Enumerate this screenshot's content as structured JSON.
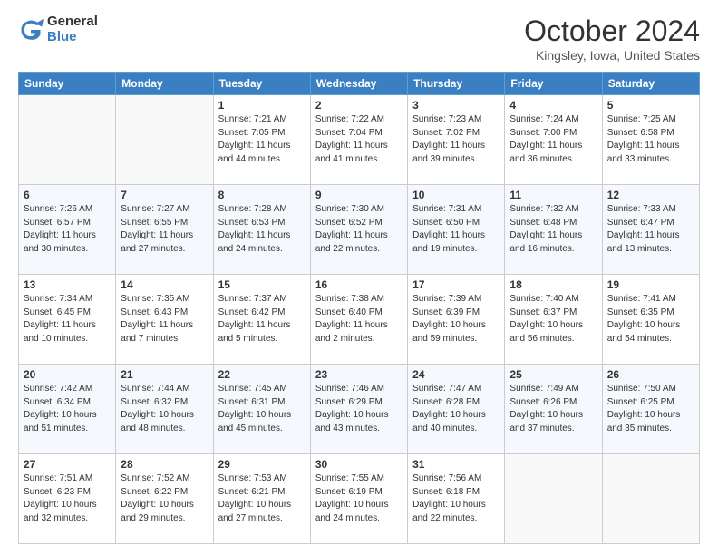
{
  "logo": {
    "general": "General",
    "blue": "Blue"
  },
  "header": {
    "month": "October 2024",
    "location": "Kingsley, Iowa, United States"
  },
  "weekdays": [
    "Sunday",
    "Monday",
    "Tuesday",
    "Wednesday",
    "Thursday",
    "Friday",
    "Saturday"
  ],
  "weeks": [
    [
      {
        "day": "",
        "sunrise": "",
        "sunset": "",
        "daylight": ""
      },
      {
        "day": "",
        "sunrise": "",
        "sunset": "",
        "daylight": ""
      },
      {
        "day": "1",
        "sunrise": "Sunrise: 7:21 AM",
        "sunset": "Sunset: 7:05 PM",
        "daylight": "Daylight: 11 hours and 44 minutes."
      },
      {
        "day": "2",
        "sunrise": "Sunrise: 7:22 AM",
        "sunset": "Sunset: 7:04 PM",
        "daylight": "Daylight: 11 hours and 41 minutes."
      },
      {
        "day": "3",
        "sunrise": "Sunrise: 7:23 AM",
        "sunset": "Sunset: 7:02 PM",
        "daylight": "Daylight: 11 hours and 39 minutes."
      },
      {
        "day": "4",
        "sunrise": "Sunrise: 7:24 AM",
        "sunset": "Sunset: 7:00 PM",
        "daylight": "Daylight: 11 hours and 36 minutes."
      },
      {
        "day": "5",
        "sunrise": "Sunrise: 7:25 AM",
        "sunset": "Sunset: 6:58 PM",
        "daylight": "Daylight: 11 hours and 33 minutes."
      }
    ],
    [
      {
        "day": "6",
        "sunrise": "Sunrise: 7:26 AM",
        "sunset": "Sunset: 6:57 PM",
        "daylight": "Daylight: 11 hours and 30 minutes."
      },
      {
        "day": "7",
        "sunrise": "Sunrise: 7:27 AM",
        "sunset": "Sunset: 6:55 PM",
        "daylight": "Daylight: 11 hours and 27 minutes."
      },
      {
        "day": "8",
        "sunrise": "Sunrise: 7:28 AM",
        "sunset": "Sunset: 6:53 PM",
        "daylight": "Daylight: 11 hours and 24 minutes."
      },
      {
        "day": "9",
        "sunrise": "Sunrise: 7:30 AM",
        "sunset": "Sunset: 6:52 PM",
        "daylight": "Daylight: 11 hours and 22 minutes."
      },
      {
        "day": "10",
        "sunrise": "Sunrise: 7:31 AM",
        "sunset": "Sunset: 6:50 PM",
        "daylight": "Daylight: 11 hours and 19 minutes."
      },
      {
        "day": "11",
        "sunrise": "Sunrise: 7:32 AM",
        "sunset": "Sunset: 6:48 PM",
        "daylight": "Daylight: 11 hours and 16 minutes."
      },
      {
        "day": "12",
        "sunrise": "Sunrise: 7:33 AM",
        "sunset": "Sunset: 6:47 PM",
        "daylight": "Daylight: 11 hours and 13 minutes."
      }
    ],
    [
      {
        "day": "13",
        "sunrise": "Sunrise: 7:34 AM",
        "sunset": "Sunset: 6:45 PM",
        "daylight": "Daylight: 11 hours and 10 minutes."
      },
      {
        "day": "14",
        "sunrise": "Sunrise: 7:35 AM",
        "sunset": "Sunset: 6:43 PM",
        "daylight": "Daylight: 11 hours and 7 minutes."
      },
      {
        "day": "15",
        "sunrise": "Sunrise: 7:37 AM",
        "sunset": "Sunset: 6:42 PM",
        "daylight": "Daylight: 11 hours and 5 minutes."
      },
      {
        "day": "16",
        "sunrise": "Sunrise: 7:38 AM",
        "sunset": "Sunset: 6:40 PM",
        "daylight": "Daylight: 11 hours and 2 minutes."
      },
      {
        "day": "17",
        "sunrise": "Sunrise: 7:39 AM",
        "sunset": "Sunset: 6:39 PM",
        "daylight": "Daylight: 10 hours and 59 minutes."
      },
      {
        "day": "18",
        "sunrise": "Sunrise: 7:40 AM",
        "sunset": "Sunset: 6:37 PM",
        "daylight": "Daylight: 10 hours and 56 minutes."
      },
      {
        "day": "19",
        "sunrise": "Sunrise: 7:41 AM",
        "sunset": "Sunset: 6:35 PM",
        "daylight": "Daylight: 10 hours and 54 minutes."
      }
    ],
    [
      {
        "day": "20",
        "sunrise": "Sunrise: 7:42 AM",
        "sunset": "Sunset: 6:34 PM",
        "daylight": "Daylight: 10 hours and 51 minutes."
      },
      {
        "day": "21",
        "sunrise": "Sunrise: 7:44 AM",
        "sunset": "Sunset: 6:32 PM",
        "daylight": "Daylight: 10 hours and 48 minutes."
      },
      {
        "day": "22",
        "sunrise": "Sunrise: 7:45 AM",
        "sunset": "Sunset: 6:31 PM",
        "daylight": "Daylight: 10 hours and 45 minutes."
      },
      {
        "day": "23",
        "sunrise": "Sunrise: 7:46 AM",
        "sunset": "Sunset: 6:29 PM",
        "daylight": "Daylight: 10 hours and 43 minutes."
      },
      {
        "day": "24",
        "sunrise": "Sunrise: 7:47 AM",
        "sunset": "Sunset: 6:28 PM",
        "daylight": "Daylight: 10 hours and 40 minutes."
      },
      {
        "day": "25",
        "sunrise": "Sunrise: 7:49 AM",
        "sunset": "Sunset: 6:26 PM",
        "daylight": "Daylight: 10 hours and 37 minutes."
      },
      {
        "day": "26",
        "sunrise": "Sunrise: 7:50 AM",
        "sunset": "Sunset: 6:25 PM",
        "daylight": "Daylight: 10 hours and 35 minutes."
      }
    ],
    [
      {
        "day": "27",
        "sunrise": "Sunrise: 7:51 AM",
        "sunset": "Sunset: 6:23 PM",
        "daylight": "Daylight: 10 hours and 32 minutes."
      },
      {
        "day": "28",
        "sunrise": "Sunrise: 7:52 AM",
        "sunset": "Sunset: 6:22 PM",
        "daylight": "Daylight: 10 hours and 29 minutes."
      },
      {
        "day": "29",
        "sunrise": "Sunrise: 7:53 AM",
        "sunset": "Sunset: 6:21 PM",
        "daylight": "Daylight: 10 hours and 27 minutes."
      },
      {
        "day": "30",
        "sunrise": "Sunrise: 7:55 AM",
        "sunset": "Sunset: 6:19 PM",
        "daylight": "Daylight: 10 hours and 24 minutes."
      },
      {
        "day": "31",
        "sunrise": "Sunrise: 7:56 AM",
        "sunset": "Sunset: 6:18 PM",
        "daylight": "Daylight: 10 hours and 22 minutes."
      },
      {
        "day": "",
        "sunrise": "",
        "sunset": "",
        "daylight": ""
      },
      {
        "day": "",
        "sunrise": "",
        "sunset": "",
        "daylight": ""
      }
    ]
  ]
}
